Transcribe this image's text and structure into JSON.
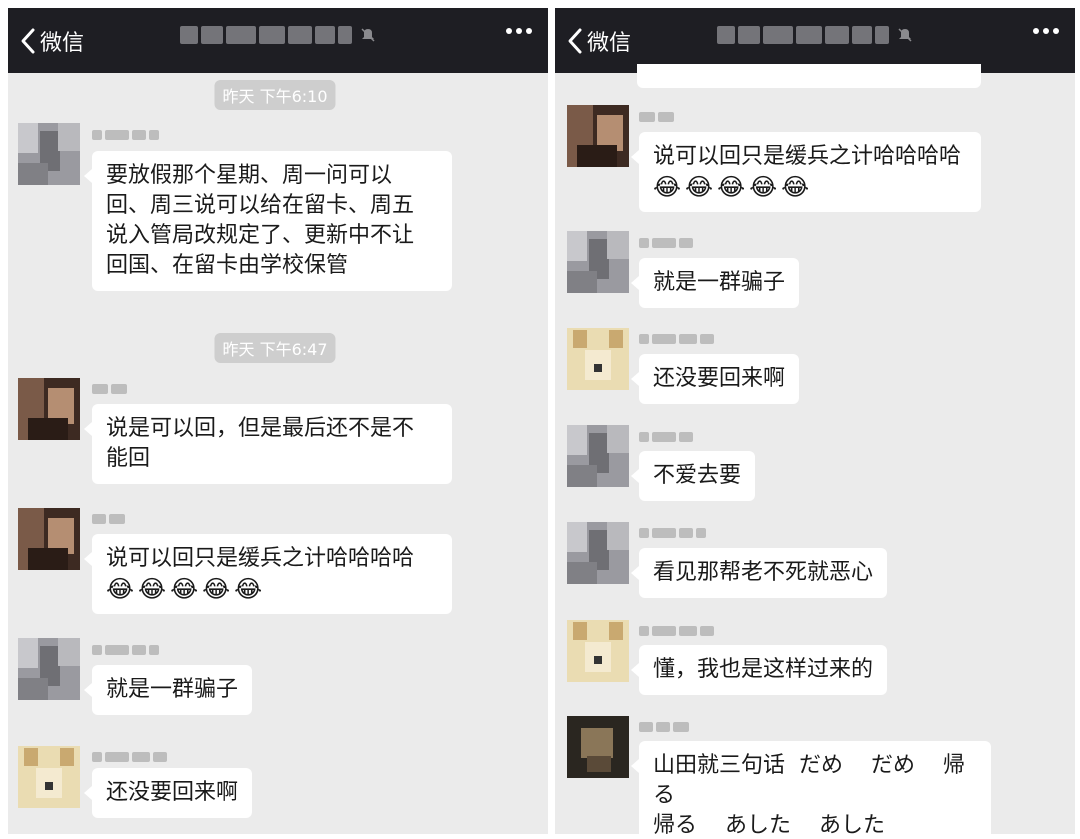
{
  "left": {
    "nav": {
      "back_label": "微信",
      "back_icon": "chevron-left-icon",
      "mute_icon": "mute-icon",
      "more_icon": "more-icon"
    },
    "timestamps": [
      "昨天 下午6:10",
      "昨天 下午6:47"
    ],
    "messages": [
      {
        "text": "要放假那个星期、周一问可以\n回、周三说可以给在留卡、周五\n说入管局改规定了、更新中不让\n回国、在留卡由学校保管"
      },
      {
        "text": "说是可以回，但是最后还不是不\n能回"
      },
      {
        "text": "说可以回只是缓兵之计哈哈哈哈",
        "emoji": "😂😂😂😂😂"
      },
      {
        "text": "就是一群骗子"
      },
      {
        "text": "还没要回来啊"
      }
    ]
  },
  "right": {
    "nav": {
      "back_label": "微信",
      "back_icon": "chevron-left-icon",
      "mute_icon": "mute-icon",
      "more_icon": "more-icon"
    },
    "messages": [
      {
        "text": "说可以回只是缓兵之计哈哈哈哈",
        "emoji": "😂😂😂😂😂"
      },
      {
        "text": "就是一群骗子"
      },
      {
        "text": "还没要回来啊"
      },
      {
        "text": "不爱去要"
      },
      {
        "text": "看见那帮老不死就恶心"
      },
      {
        "text": "懂，我也是这样过来的"
      },
      {
        "text": "山田就三句话  だめ    だめ    帰る\n帰る    あした    あした"
      }
    ]
  },
  "colors": {
    "navbar": "#1e1e23",
    "background": "#ebebeb",
    "bubble": "#ffffff",
    "timestamp_bg": "#cecece"
  }
}
